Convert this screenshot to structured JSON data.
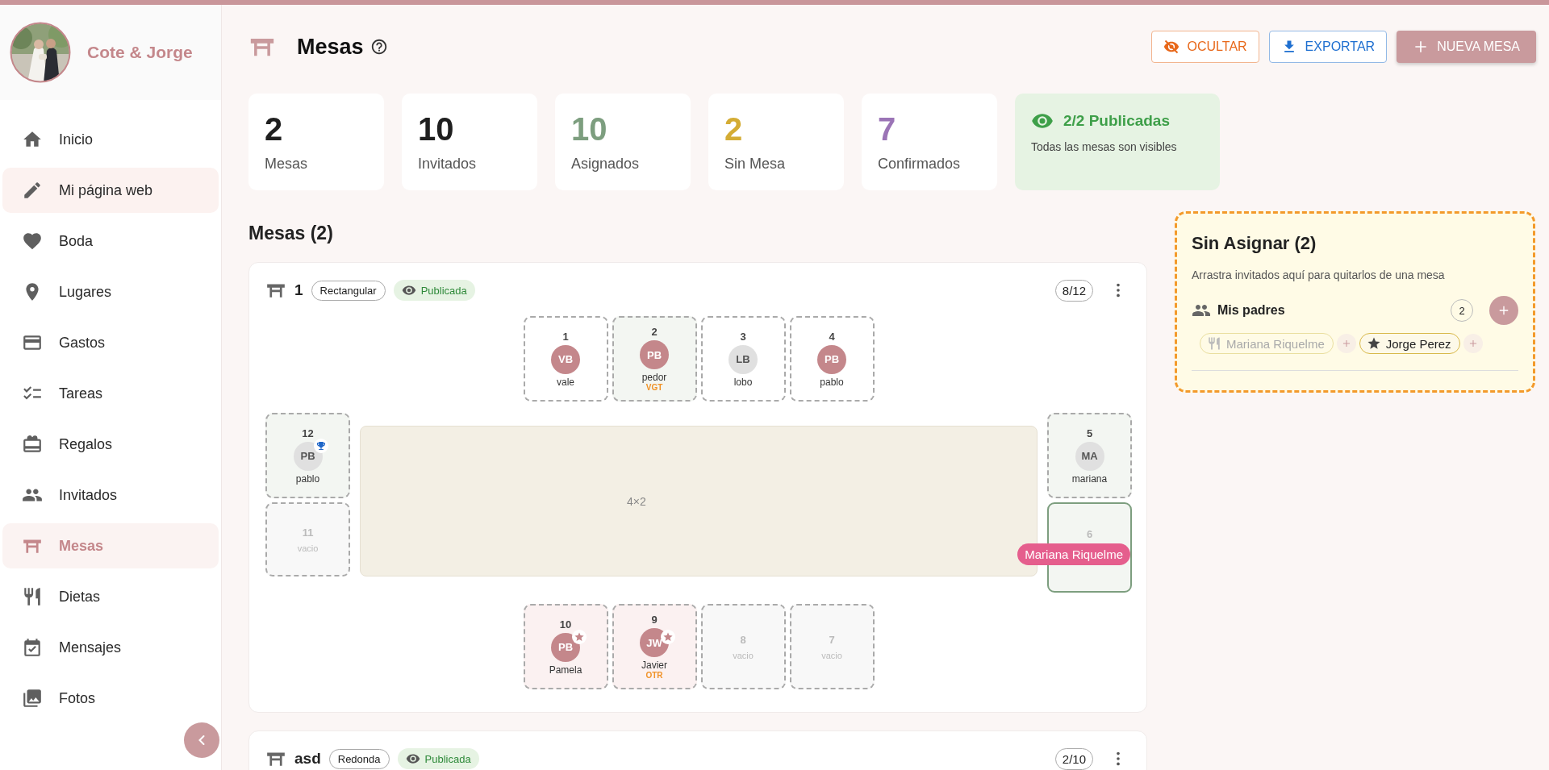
{
  "brand": {
    "name": "Cote & Jorge"
  },
  "sidebar": {
    "items": [
      {
        "label": "Inicio",
        "selected": false,
        "hovered": false
      },
      {
        "label": "Mi página web",
        "selected": false,
        "hovered": true
      },
      {
        "label": "Boda",
        "selected": false,
        "hovered": false
      },
      {
        "label": "Lugares",
        "selected": false,
        "hovered": false
      },
      {
        "label": "Gastos",
        "selected": false,
        "hovered": false
      },
      {
        "label": "Tareas",
        "selected": false,
        "hovered": false
      },
      {
        "label": "Regalos",
        "selected": false,
        "hovered": false
      },
      {
        "label": "Invitados",
        "selected": false,
        "hovered": false
      },
      {
        "label": "Mesas",
        "selected": true,
        "hovered": false
      },
      {
        "label": "Dietas",
        "selected": false,
        "hovered": false
      },
      {
        "label": "Mensajes",
        "selected": false,
        "hovered": false
      },
      {
        "label": "Fotos",
        "selected": false,
        "hovered": false
      }
    ]
  },
  "header": {
    "title": "Mesas",
    "buttons": [
      {
        "label": "OCULTAR",
        "kind": "warning"
      },
      {
        "label": "EXPORTAR",
        "kind": "info"
      },
      {
        "label": "NUEVA MESA",
        "kind": "primary"
      }
    ]
  },
  "stats": [
    {
      "value": "2",
      "label": "Mesas",
      "color": "#1f1f1f"
    },
    {
      "value": "10",
      "label": "Invitados",
      "color": "#1f1f1f"
    },
    {
      "value": "10",
      "label": "Asignados",
      "color": "#7d9e7f"
    },
    {
      "value": "2",
      "label": "Sin Mesa",
      "color": "#d4ac34"
    },
    {
      "value": "7",
      "label": "Confirmados",
      "color": "#9b74b6"
    }
  ],
  "published": {
    "title": "2/2 Publicadas",
    "subtitle": "Todas las mesas son visibles"
  },
  "tables_heading": "Mesas (2)",
  "tables": [
    {
      "name": "1",
      "shape": "Rectangular",
      "status": "Publicada",
      "count": "8/12",
      "layout": "4×2",
      "drag_chip": "Mariana Riquelme",
      "top": [
        {
          "number": "1",
          "kind": "guest",
          "initials": "VB",
          "name": "vale",
          "confirmed": true,
          "color": "#ffffff",
          "drop_target": false
        },
        {
          "number": "2",
          "kind": "guest",
          "initials": "PB",
          "name": "pedor",
          "tag": "VGT",
          "confirmed": true,
          "color": "#f3f6f2",
          "drop_target": false
        },
        {
          "number": "3",
          "kind": "guest",
          "initials": "LB",
          "name": "lobo",
          "confirmed": false,
          "color": "#ffffff",
          "drop_target": false
        },
        {
          "number": "4",
          "kind": "guest",
          "initials": "PB",
          "name": "pablo",
          "confirmed": true,
          "color": "#ffffff",
          "drop_target": false
        }
      ],
      "left": [
        {
          "number": "12",
          "kind": "guest",
          "initials": "PB",
          "name": "pablo",
          "awarded": true,
          "starred": false,
          "confirmed": false,
          "color": "#f3f6f2",
          "drop_target": false
        },
        {
          "number": "11",
          "kind": "empty",
          "label": "vacio",
          "color": "#f8f8f8",
          "drop_target": false
        }
      ],
      "right": [
        {
          "number": "5",
          "kind": "guest",
          "initials": "MA",
          "name": "mariana",
          "confirmed": false,
          "color": "#f3f6f2",
          "drop_target": false
        },
        {
          "number": "6",
          "kind": "empty",
          "color": "#f3f6f2",
          "drop_target": true
        }
      ],
      "bottom": [
        {
          "number": "10",
          "kind": "guest",
          "initials": "PB",
          "name": "Pamela",
          "awarded": false,
          "starred": true,
          "confirmed": true,
          "color": "#fbf1f1",
          "drop_target": false
        },
        {
          "number": "9",
          "kind": "guest",
          "initials": "JW",
          "name": "Javier",
          "tag": "OTR",
          "awarded": false,
          "starred": true,
          "confirmed": true,
          "color": "#fbf1f1",
          "drop_target": false
        },
        {
          "number": "8",
          "kind": "empty",
          "label": "vacio",
          "color": "#f8f8f8",
          "drop_target": false
        },
        {
          "number": "7",
          "kind": "empty",
          "label": "vacio",
          "color": "#f8f8f8",
          "drop_target": false
        }
      ]
    },
    {
      "name": "asd",
      "shape": "Redonda",
      "status": "Publicada",
      "count": "2/10"
    }
  ],
  "unassigned": {
    "title": "Sin Asignar (2)",
    "hint": "Arrastra invitados aquí para quitarlos de una mesa",
    "groups": [
      {
        "name": "Mis padres",
        "count": "2",
        "guests": [
          {
            "name": "Mariana Riquelme",
            "starred": false,
            "dragging": true
          },
          {
            "name": "Jorge Perez",
            "starred": true,
            "dragging": false
          }
        ]
      }
    ]
  }
}
